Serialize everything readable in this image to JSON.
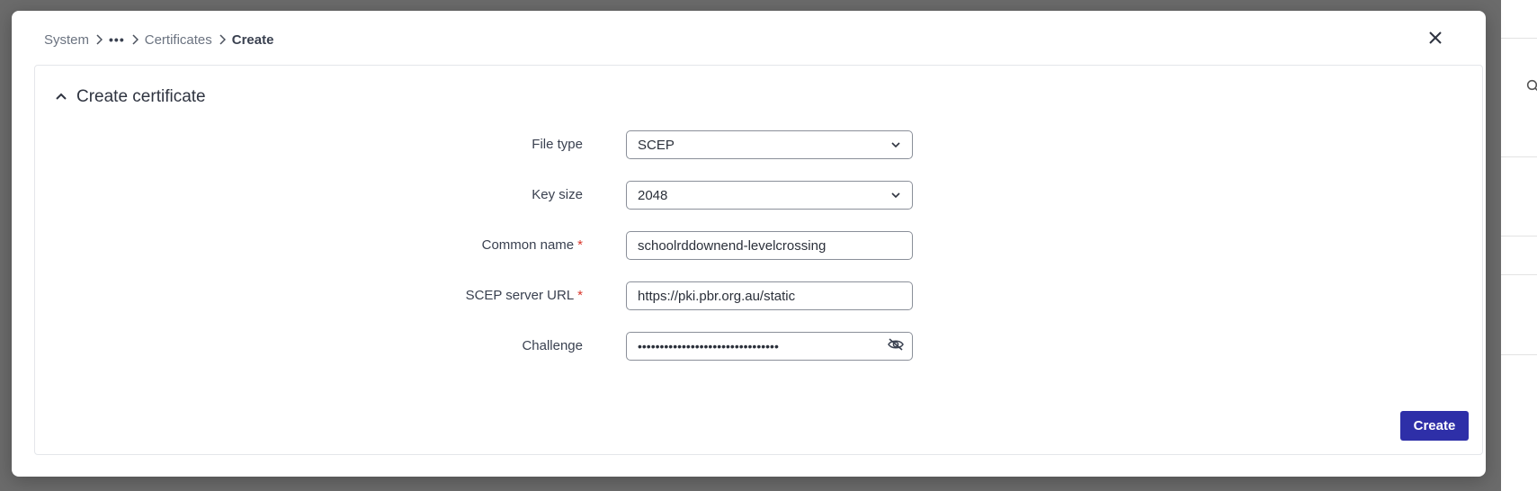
{
  "breadcrumb": {
    "items": [
      "System",
      "•••",
      "Certificates",
      "Create"
    ]
  },
  "panel": {
    "title": "Create certificate"
  },
  "form": {
    "file_type": {
      "label": "File type",
      "value": "SCEP"
    },
    "key_size": {
      "label": "Key size",
      "value": "2048"
    },
    "common_name": {
      "label": "Common name",
      "required_mark": "*",
      "value": "schoolrddownend-levelcrossing"
    },
    "scep_url": {
      "label": "SCEP server URL",
      "required_mark": "*",
      "value": "https://pki.pbr.org.au/static"
    },
    "challenge": {
      "label": "Challenge",
      "value": "••••••••••••••••••••••••••••••••"
    }
  },
  "actions": {
    "create_label": "Create"
  },
  "colors": {
    "primary_button": "#2e2fa8",
    "required": "#d9362b",
    "overlay": "#6b6b6b"
  },
  "icons": {
    "close": "close-icon",
    "collapse": "chevron-up-icon",
    "dropdown": "chevron-down-icon",
    "breadcrumb_separator": "chevron-right-icon",
    "visibility": "eye-off-icon"
  }
}
